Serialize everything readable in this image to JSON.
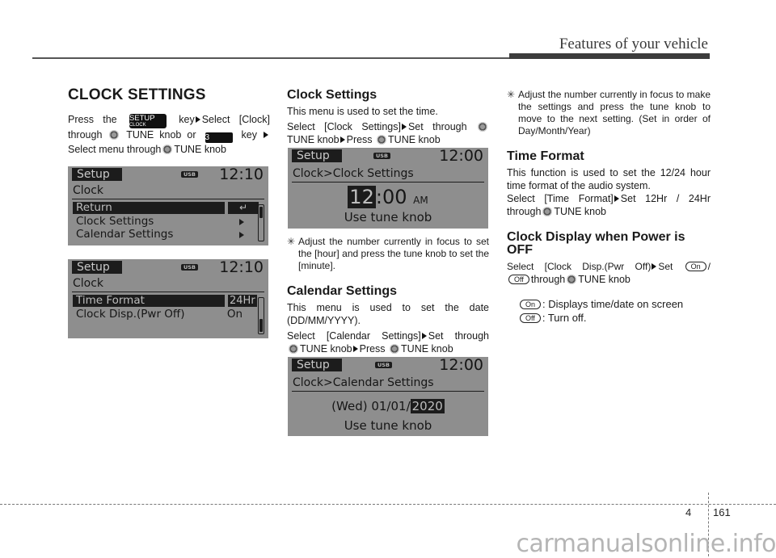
{
  "header": {
    "section_title": "Features of your vehicle"
  },
  "col1": {
    "heading": "CLOCK SETTINGS",
    "line1_a": "Press the",
    "setup_key": {
      "top": "SETUP",
      "bottom": "CLOCK"
    },
    "line1_b": "key",
    "line1_c": "Select [Clock]",
    "line2_a": "through",
    "line2_b": "TUNE knob or",
    "num_key": "3",
    "line2_c": "key",
    "line3_a": "Select menu through",
    "line3_b": "TUNE knob",
    "screen1": {
      "tab": "Setup",
      "usb": "USB",
      "time": "12:10",
      "crumb": "Clock",
      "rows": [
        {
          "label": "Return",
          "value": "↵",
          "selected": true
        },
        {
          "label": "Clock Settings",
          "value": "▶"
        },
        {
          "label": "Calendar Settings",
          "value": "▶"
        }
      ]
    },
    "screen2": {
      "tab": "Setup",
      "usb": "USB",
      "time": "12:10",
      "crumb": "Clock",
      "rows": [
        {
          "label": "Time Format",
          "value": "24Hr",
          "selected": true
        },
        {
          "label": "Clock Disp.(Pwr Off)",
          "value": "On"
        }
      ]
    }
  },
  "col2": {
    "clock_settings": {
      "heading": "Clock Settings",
      "desc": "This menu is used to set the time.",
      "instr_a": "Select [Clock Settings]",
      "instr_b": "Set through",
      "instr_c": "TUNE knob",
      "instr_d": "Press",
      "instr_e": "TUNE knob",
      "screen": {
        "tab": "Setup",
        "usb": "USB",
        "time": "12:00",
        "crumb": "Clock>Clock Settings",
        "hour": "12",
        "sep": ":",
        "minute": "00",
        "ampm": "AM",
        "hint": "Use tune knob"
      },
      "note_mark": "✳",
      "note": "Adjust the number currently in focus to set the [hour] and press the tune knob to set the [minute]."
    },
    "calendar_settings": {
      "heading": "Calendar Settings",
      "desc": "This menu is used to set the date (DD/MM/YYYY).",
      "instr_a": "Select [Calendar Settings]",
      "instr_b": "Set through",
      "instr_c": "TUNE knob",
      "instr_d": "Press",
      "instr_e": "TUNE knob",
      "screen": {
        "tab": "Setup",
        "usb": "USB",
        "time": "12:00",
        "crumb": "Clock>Calendar Settings",
        "date": "(Wed) 01/01/",
        "year": "2020",
        "hint": "Use tune knob"
      }
    }
  },
  "col3": {
    "note_mark": "✳",
    "note": "Adjust the number currently in focus to make the settings and press the tune knob to move to the next setting. (Set in order of Day/Month/Year)",
    "time_format": {
      "heading": "Time Format",
      "desc": "This function is used to set the 12/24 hour time format of the audio system.",
      "instr_a": "Select [Time Format]",
      "instr_b": "Set 12Hr / 24Hr",
      "instr_c": "through",
      "instr_d": "TUNE knob"
    },
    "clock_display": {
      "heading": "Clock Display when Power is OFF",
      "instr_a": "Select [Clock Disp.(Pwr Off)",
      "instr_b": "Set",
      "on": "On",
      "slash": "/",
      "off": "Off",
      "instr_c": "through",
      "instr_d": "TUNE knob",
      "on_desc": ": Displays time/date on screen",
      "off_desc": ": Turn off."
    }
  },
  "footer": {
    "chapter": "4",
    "page": "161",
    "watermark": "carmanualsonline.info"
  }
}
